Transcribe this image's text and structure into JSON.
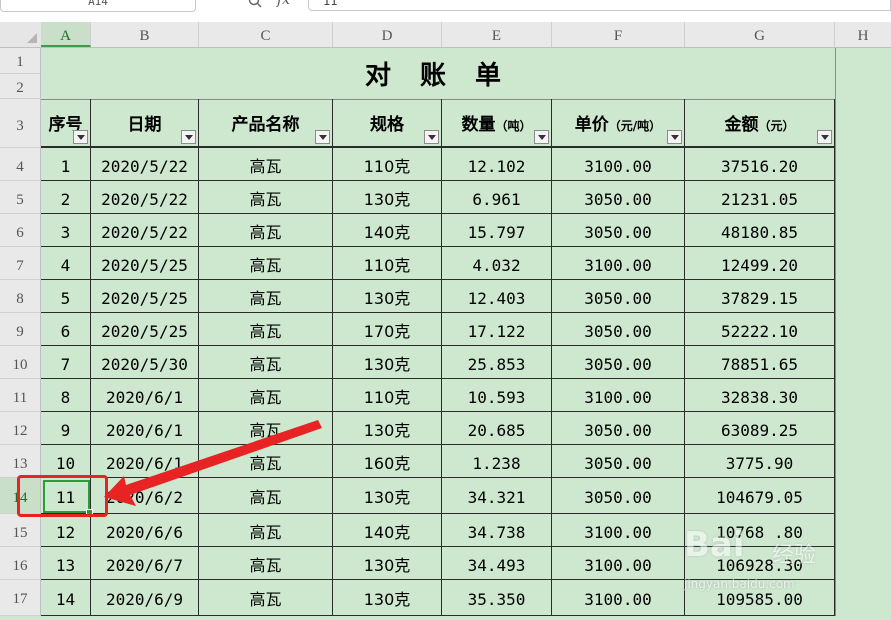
{
  "name_box": "A14",
  "formula": "11",
  "fx_label": "fx",
  "column_headers": [
    "A",
    "B",
    "C",
    "D",
    "E",
    "F",
    "G",
    "H"
  ],
  "row_headers": [
    "1",
    "2",
    "3",
    "4",
    "5",
    "6",
    "7",
    "8",
    "9",
    "10",
    "11",
    "12",
    "13",
    "14",
    "15",
    "16",
    "17"
  ],
  "active_cell": {
    "column": "A",
    "row": "14"
  },
  "sheet_title": "对 账 单",
  "table_headers": [
    {
      "label": "序号",
      "unit": ""
    },
    {
      "label": "日期",
      "unit": ""
    },
    {
      "label": "产品名称",
      "unit": ""
    },
    {
      "label": "规格",
      "unit": ""
    },
    {
      "label": "数量",
      "unit": "（吨）"
    },
    {
      "label": "单价",
      "unit": "（元/吨）"
    },
    {
      "label": "金额",
      "unit": "（元）"
    }
  ],
  "rows": [
    [
      "1",
      "2020/5/22",
      "高瓦",
      "110克",
      "12.102",
      "3100.00",
      "37516.20"
    ],
    [
      "2",
      "2020/5/22",
      "高瓦",
      "130克",
      "6.961",
      "3050.00",
      "21231.05"
    ],
    [
      "3",
      "2020/5/22",
      "高瓦",
      "140克",
      "15.797",
      "3050.00",
      "48180.85"
    ],
    [
      "4",
      "2020/5/25",
      "高瓦",
      "110克",
      "4.032",
      "3100.00",
      "12499.20"
    ],
    [
      "5",
      "2020/5/25",
      "高瓦",
      "130克",
      "12.403",
      "3050.00",
      "37829.15"
    ],
    [
      "6",
      "2020/5/25",
      "高瓦",
      "170克",
      "17.122",
      "3050.00",
      "52222.10"
    ],
    [
      "7",
      "2020/5/30",
      "高瓦",
      "130克",
      "25.853",
      "3050.00",
      "78851.65"
    ],
    [
      "8",
      "2020/6/1",
      "高瓦",
      "110克",
      "10.593",
      "3100.00",
      "32838.30"
    ],
    [
      "9",
      "2020/6/1",
      "高瓦",
      "130克",
      "20.685",
      "3050.00",
      "63089.25"
    ],
    [
      "10",
      "2020/6/1",
      "高瓦",
      "160克",
      "1.238",
      "3050.00",
      "3775.90"
    ],
    [
      "11",
      "2020/6/2",
      "高瓦",
      "130克",
      "34.321",
      "3050.00",
      "104679.05"
    ],
    [
      "12",
      "2020/6/6",
      "高瓦",
      "140克",
      "34.738",
      "3100.00",
      "10768 .80"
    ],
    [
      "13",
      "2020/6/7",
      "高瓦",
      "130克",
      "34.493",
      "3100.00",
      "106928.30"
    ],
    [
      "14",
      "2020/6/9",
      "高瓦",
      "130克",
      "35.350",
      "3100.00",
      "109585.00"
    ]
  ],
  "watermark": {
    "logo": "Bai",
    "text": "经验",
    "url": "jingyan.baidu.com"
  },
  "colors": {
    "sheet_bg": "#cde8cf",
    "selection": "#2e9b3a",
    "annotation": "#e82323"
  }
}
